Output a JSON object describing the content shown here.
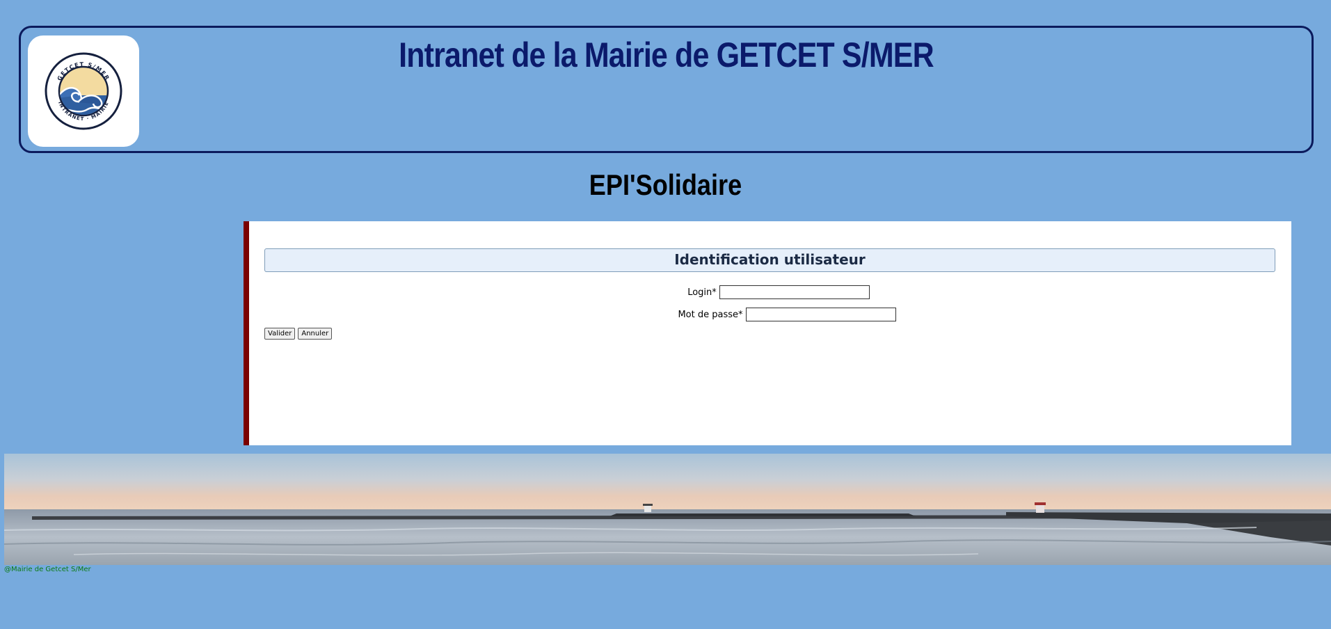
{
  "header": {
    "title": "Intranet de la Mairie de GETCET S/MER",
    "logo": {
      "top_text": "GETCET S/MER",
      "bottom_text": "INTRANET · MAIRIE"
    }
  },
  "app": {
    "title": "EPI'Solidaire"
  },
  "login_form": {
    "section_title": "Identification utilisateur",
    "login_label": "Login*",
    "login_value": "",
    "password_label": "Mot de passe*",
    "password_value": "",
    "submit_label": "Valider",
    "cancel_label": "Annuler"
  },
  "banner": {
    "icon": "seaside-photo"
  },
  "footer": {
    "copyright": "@Mairie de Getcet S/Mer"
  },
  "colors": {
    "background": "#77aadd",
    "header_border": "#0b1a5c",
    "title": "#0b1a6b",
    "panel_accent": "#7a0000",
    "footer_text": "#0a7a10"
  }
}
